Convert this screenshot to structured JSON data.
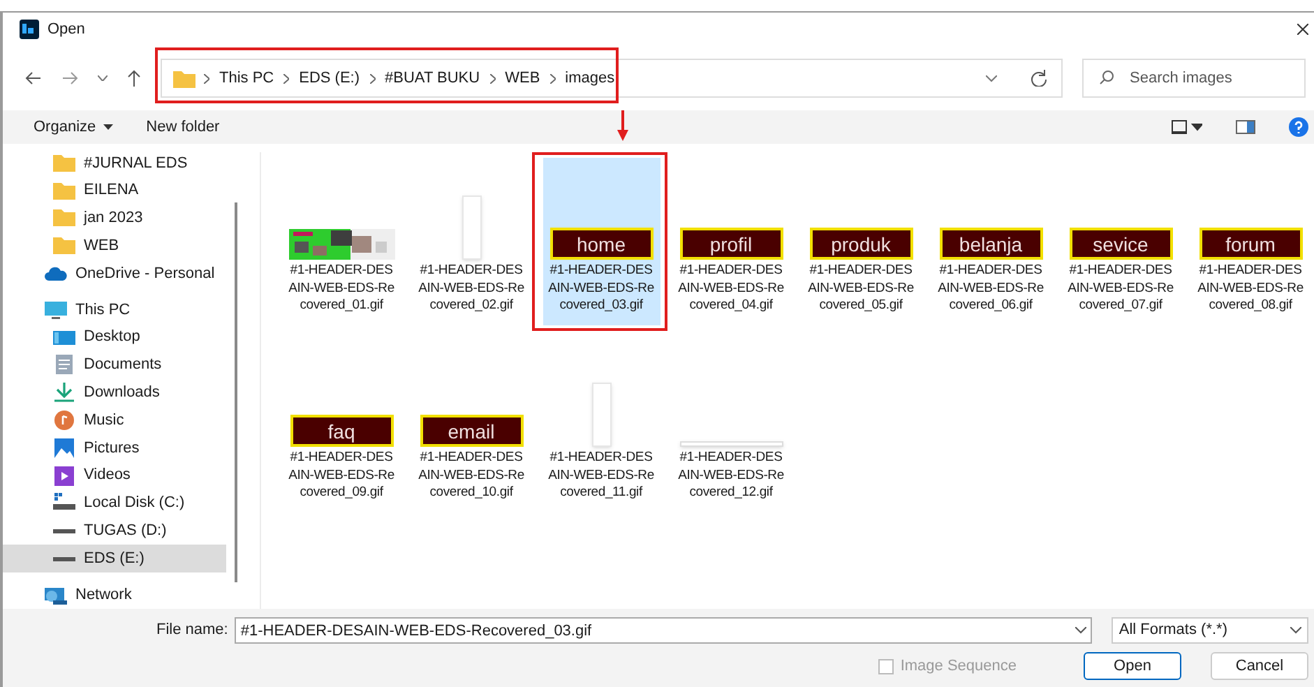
{
  "window": {
    "title": "Open"
  },
  "breadcrumb": {
    "highlighted": true,
    "parts": [
      "This PC",
      "EDS (E:)",
      "#BUAT BUKU",
      "WEB",
      "images"
    ]
  },
  "search": {
    "placeholder": "Search images"
  },
  "toolbar": {
    "organize": "Organize",
    "new_folder": "New folder"
  },
  "sidebar": {
    "items": [
      {
        "label": "#JURNAL EDS",
        "kind": "folder",
        "selected": false
      },
      {
        "label": "EILENA",
        "kind": "folder",
        "selected": false
      },
      {
        "label": "jan 2023",
        "kind": "folder",
        "selected": false
      },
      {
        "label": "WEB",
        "kind": "folder",
        "selected": false
      },
      {
        "label": "OneDrive - Personal",
        "kind": "cloud",
        "selected": false
      },
      {
        "label": "This PC",
        "kind": "pc",
        "selected": false,
        "children": [
          {
            "label": "Desktop",
            "kind": "desktop",
            "selected": false
          },
          {
            "label": "Documents",
            "kind": "documents",
            "selected": false
          },
          {
            "label": "Downloads",
            "kind": "downloads",
            "selected": false
          },
          {
            "label": "Music",
            "kind": "music",
            "selected": false
          },
          {
            "label": "Pictures",
            "kind": "pictures",
            "selected": false
          },
          {
            "label": "Videos",
            "kind": "videos",
            "selected": false
          },
          {
            "label": "Local Disk (C:)",
            "kind": "localdisk",
            "selected": false
          },
          {
            "label": "TUGAS (D:)",
            "kind": "drive",
            "selected": false
          },
          {
            "label": "EDS (E:)",
            "kind": "drive",
            "selected": true
          }
        ]
      },
      {
        "label": "Network",
        "kind": "network",
        "selected": false
      }
    ]
  },
  "files": [
    {
      "name": "#1-HEADER-DES AIN-WEB-EDS-Re covered_01.gif",
      "kind": "banner",
      "selected": false,
      "highlighted": false
    },
    {
      "name": "#1-HEADER-DES AIN-WEB-EDS-Re covered_02.gif",
      "kind": "blank_tall",
      "selected": false,
      "highlighted": false
    },
    {
      "name": "#1-HEADER-DES AIN-WEB-EDS-Re covered_03.gif",
      "kind": "button",
      "thumb_text": "home",
      "selected": true,
      "highlighted": true
    },
    {
      "name": "#1-HEADER-DES AIN-WEB-EDS-Re covered_04.gif",
      "kind": "button",
      "thumb_text": "profil",
      "selected": false,
      "highlighted": false
    },
    {
      "name": "#1-HEADER-DES AIN-WEB-EDS-Re covered_05.gif",
      "kind": "button",
      "thumb_text": "produk",
      "selected": false,
      "highlighted": false
    },
    {
      "name": "#1-HEADER-DES AIN-WEB-EDS-Re covered_06.gif",
      "kind": "button",
      "thumb_text": "belanja",
      "selected": false,
      "highlighted": false
    },
    {
      "name": "#1-HEADER-DES AIN-WEB-EDS-Re covered_07.gif",
      "kind": "button",
      "thumb_text": "sevice",
      "selected": false,
      "highlighted": false
    },
    {
      "name": "#1-HEADER-DES AIN-WEB-EDS-Re covered_08.gif",
      "kind": "button",
      "thumb_text": "forum",
      "selected": false,
      "highlighted": false
    },
    {
      "name": "#1-HEADER-DES AIN-WEB-EDS-Re covered_09.gif",
      "kind": "button",
      "thumb_text": "faq",
      "selected": false,
      "highlighted": false
    },
    {
      "name": "#1-HEADER-DES AIN-WEB-EDS-Re covered_10.gif",
      "kind": "button",
      "thumb_text": "email",
      "selected": false,
      "highlighted": false
    },
    {
      "name": "#1-HEADER-DES AIN-WEB-EDS-Re covered_11.gif",
      "kind": "blank_tall",
      "selected": false,
      "highlighted": false
    },
    {
      "name": "#1-HEADER-DES AIN-WEB-EDS-Re covered_12.gif",
      "kind": "blank_wide",
      "selected": false,
      "highlighted": false
    }
  ],
  "footer": {
    "file_name_label": "File name:",
    "file_name": "#1-HEADER-DESAIN-WEB-EDS-Recovered_03.gif",
    "format": "All Formats (*.*)",
    "image_sequence": {
      "label": "Image Sequence",
      "checked": false,
      "disabled": true
    },
    "open": "Open",
    "cancel": "Cancel"
  }
}
